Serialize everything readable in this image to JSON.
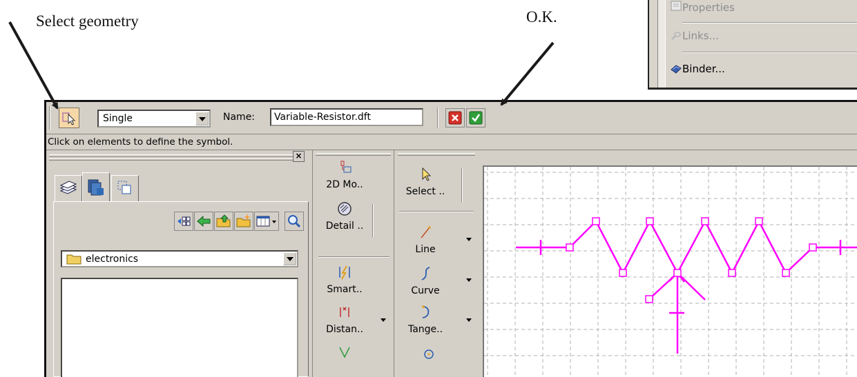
{
  "annotations": {
    "select_geometry": "Select geometry",
    "ok": "O.K."
  },
  "context_menu": {
    "items": [
      {
        "label": "Properties",
        "disabled": true,
        "icon": "properties-icon"
      },
      {
        "label": "Links...",
        "disabled": true,
        "icon": "links-icon"
      },
      {
        "label": "Binder...",
        "disabled": false,
        "icon": "binder-icon"
      }
    ]
  },
  "toolbar": {
    "select_mode": "Single",
    "name_label": "Name:",
    "name_value": "Variable-Resistor.dft",
    "icons": [
      "select-geometry-icon",
      "cancel-icon",
      "accept-icon"
    ]
  },
  "status": {
    "prompt": "Click on elements to define the symbol."
  },
  "library_pane": {
    "close_label": "×",
    "tabs": [
      "layers-tab",
      "library-tab",
      "groups-tab"
    ],
    "folder": "electronics"
  },
  "commands": {
    "col1": [
      {
        "label": "2D Mo..",
        "icon": "2d-model-icon"
      },
      {
        "label": "Detail ..",
        "icon": "detail-icon"
      },
      {
        "label": "Smart..",
        "icon": "smart-dimension-icon"
      },
      {
        "label": "Distan..",
        "icon": "distance-icon"
      }
    ],
    "col2": [
      {
        "label": "Select ..",
        "icon": "select-arrow-icon"
      },
      {
        "label": "Line",
        "icon": "line-icon"
      },
      {
        "label": "Curve",
        "icon": "curve-icon"
      },
      {
        "label": "Tange..",
        "icon": "tangent-arc-icon"
      }
    ]
  },
  "colors": {
    "geometry": "#ff00ff",
    "grid": "#b0b0b0",
    "window": "#d4d0c8"
  }
}
